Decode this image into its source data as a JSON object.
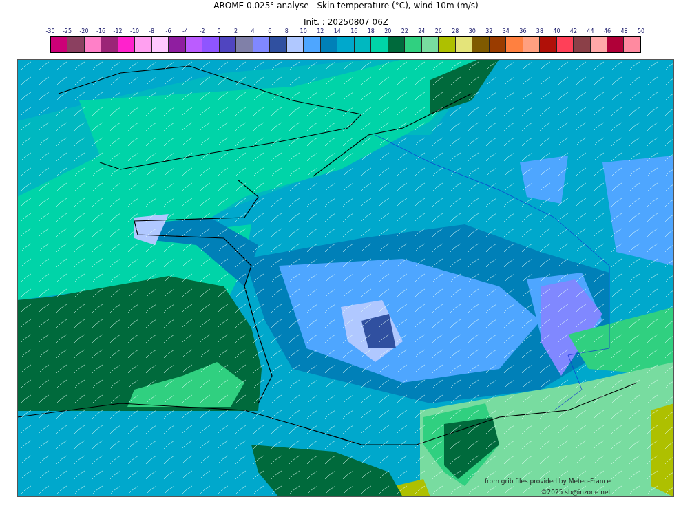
{
  "title": "AROME 0.025° analyse - Skin temperature (°C), wind 10m (m/s)",
  "subtitle": "Init. : 20250807 06Z",
  "colorbar": {
    "ticks": [
      "-30",
      "-25",
      "-20",
      "-16",
      "-12",
      "-10",
      "-8",
      "-6",
      "-4",
      "-2",
      "0",
      "2",
      "4",
      "6",
      "8",
      "10",
      "12",
      "14",
      "16",
      "18",
      "20",
      "22",
      "24",
      "26",
      "28",
      "30",
      "32",
      "34",
      "36",
      "38",
      "40",
      "42",
      "44",
      "46",
      "48",
      "50"
    ],
    "swatches": [
      {
        "color": "#cc0077"
      },
      {
        "color": "#8b4060"
      },
      {
        "color": "#ff80c8"
      },
      {
        "color": "#9b2577"
      },
      {
        "color": "#ff22cc"
      },
      {
        "color": "#ffa0f0"
      },
      {
        "color": "#ffc8ff"
      },
      {
        "color": "#8f1ea0"
      },
      {
        "color": "#bb5cff"
      },
      {
        "color": "#8f55ff"
      },
      {
        "color": "#5045c0"
      },
      {
        "color": "#8080a8"
      },
      {
        "color": "#8088ff"
      },
      {
        "color": "#3050a0"
      },
      {
        "color": "#b0c8ff"
      },
      {
        "color": "#4ea6ff"
      },
      {
        "color": "#0080b8"
      },
      {
        "color": "#00a8cc"
      },
      {
        "color": "#00b8c0"
      },
      {
        "color": "#00d4a8"
      },
      {
        "color": "#006a3c"
      },
      {
        "color": "#30d080"
      },
      {
        "color": "#78dca0"
      },
      {
        "color": "#aec000"
      },
      {
        "color": "#e4e47a"
      },
      {
        "color": "#7f5a00"
      },
      {
        "color": "#9a3c00"
      },
      {
        "color": "#ff8040"
      },
      {
        "color": "#ffa080"
      },
      {
        "color": "#b01008"
      },
      {
        "color": "#ff4058"
      },
      {
        "color": "#8b4048"
      },
      {
        "color": "#ffa8a8"
      },
      {
        "color": "#b00038"
      },
      {
        "color": "#ff8aa0"
      }
    ]
  },
  "credits": [
    "from grib files provided by Meteo-France",
    "©2025 sb@inzone.net"
  ]
}
